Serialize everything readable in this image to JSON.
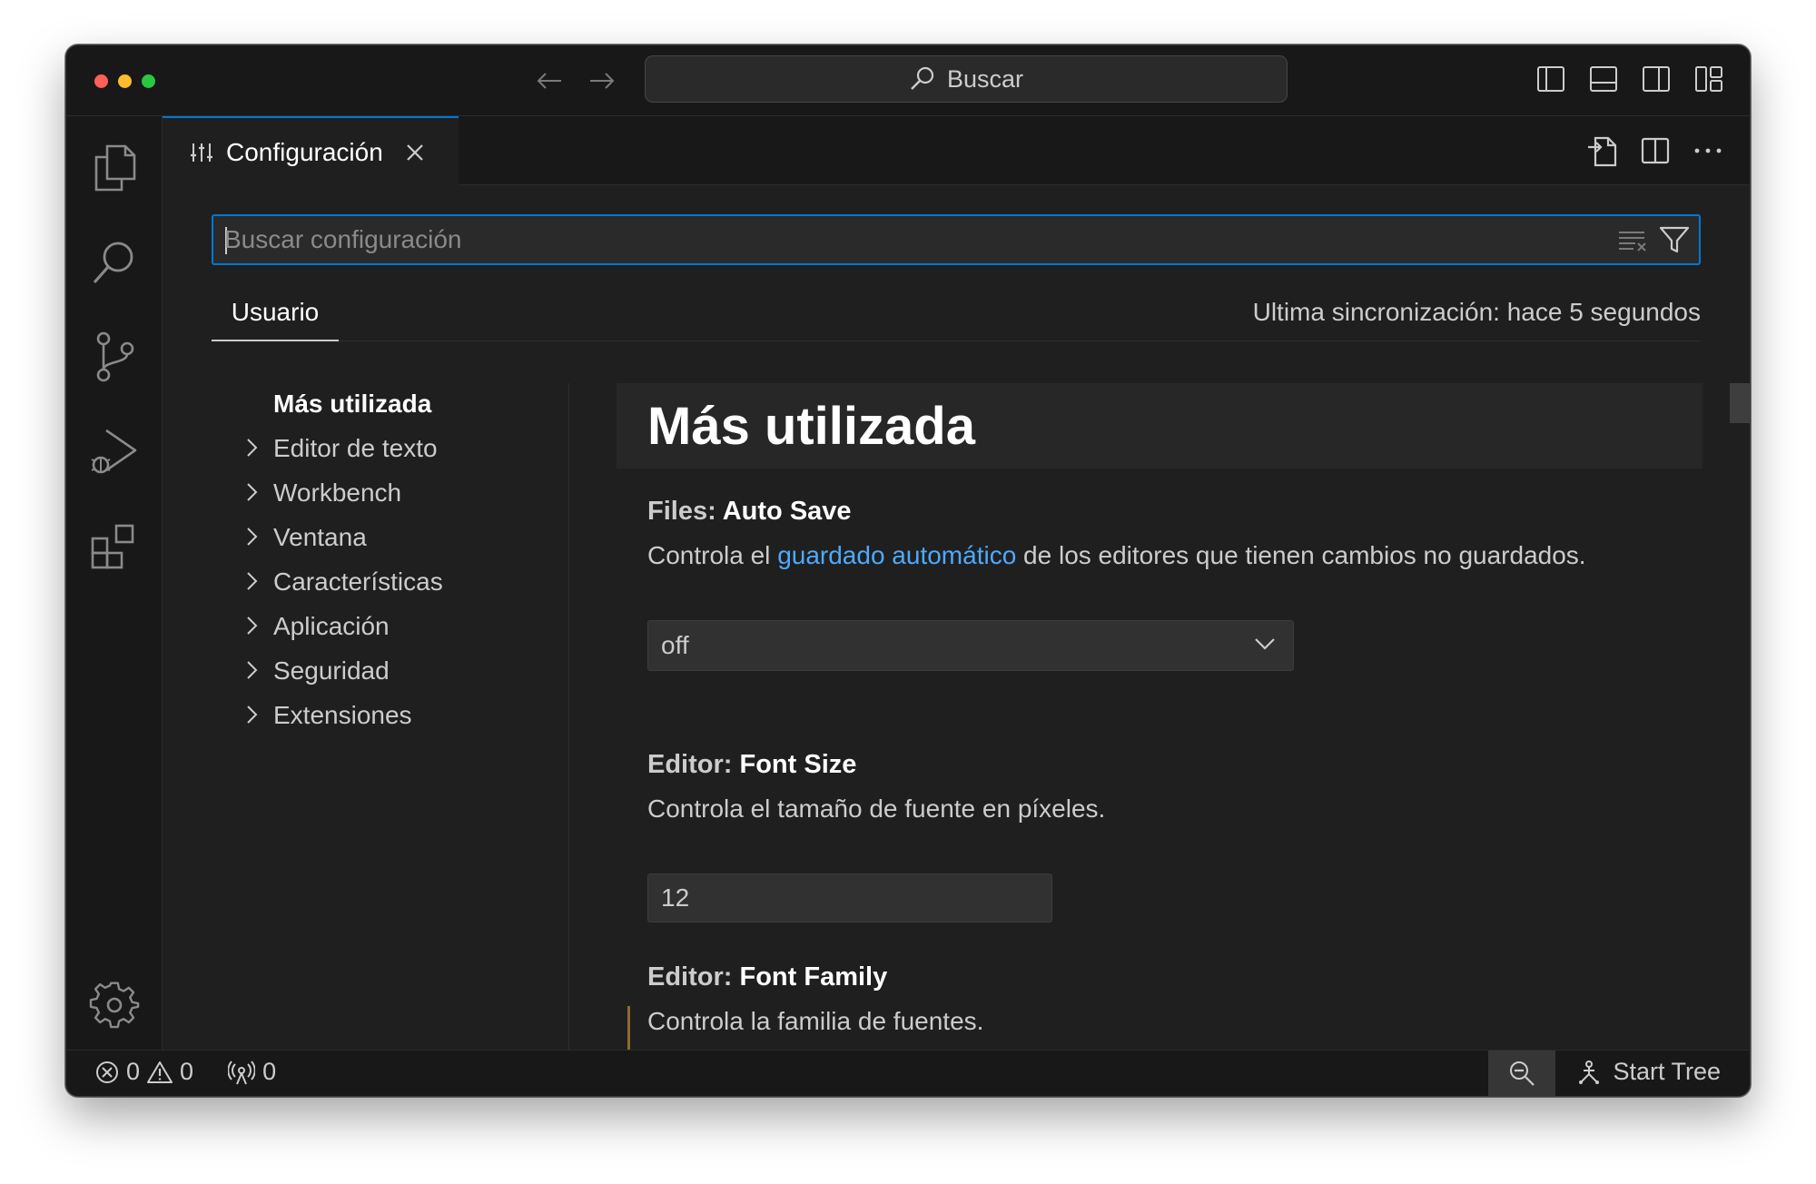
{
  "titlebar": {
    "search_label": "Buscar"
  },
  "tab": {
    "label": "Configuración"
  },
  "settings_search": {
    "placeholder": "Buscar configuración"
  },
  "scope": {
    "tab_label": "Usuario",
    "sync_status": "Ultima sincronización: hace 5 segundos"
  },
  "toc": {
    "items": [
      {
        "label": "Más utilizada",
        "active": true
      },
      {
        "label": "Editor de texto"
      },
      {
        "label": "Workbench"
      },
      {
        "label": "Ventana"
      },
      {
        "label": "Características"
      },
      {
        "label": "Aplicación"
      },
      {
        "label": "Seguridad"
      },
      {
        "label": "Extensiones"
      }
    ]
  },
  "content": {
    "section_title": "Más utilizada",
    "settings": [
      {
        "category": "Files: ",
        "name": "Auto Save",
        "desc_before": "Controla el ",
        "desc_link": "guardado automático",
        "desc_after": " de los editores que tienen cambios no guardados.",
        "value": "off"
      },
      {
        "category": "Editor: ",
        "name": "Font Size",
        "desc": "Controla el tamaño de fuente en píxeles.",
        "value": "12"
      },
      {
        "category": "Editor: ",
        "name": "Font Family",
        "desc": "Controla la familia de fuentes."
      }
    ]
  },
  "statusbar": {
    "errors": "0",
    "warnings": "0",
    "ports": "0",
    "tree_label": "Start Tree"
  },
  "colors": {
    "accent": "#0078d4",
    "link": "#4daafc",
    "background": "#1f1f1f",
    "chrome": "#181818"
  }
}
